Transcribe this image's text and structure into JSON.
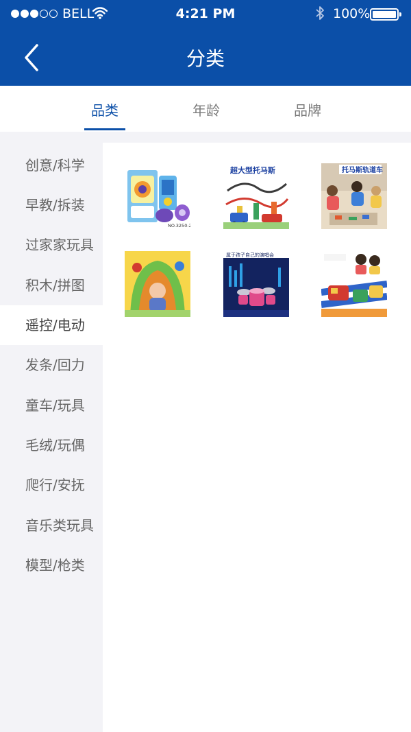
{
  "status_bar": {
    "carrier": "BELL",
    "time": "4:21 PM",
    "battery": "100%",
    "signal_bars_filled": 3,
    "signal_bars_total": 5
  },
  "nav": {
    "title": "分类",
    "back_icon": "chevron-left-icon"
  },
  "tabs": [
    {
      "label": "品类",
      "active": true
    },
    {
      "label": "年龄",
      "active": false
    },
    {
      "label": "品牌",
      "active": false
    }
  ],
  "categories": [
    {
      "label": "创意/科学"
    },
    {
      "label": "早教/拆装"
    },
    {
      "label": "过家家玩具"
    },
    {
      "label": "积木/拼图"
    },
    {
      "label": "遥控/电动",
      "active": true
    },
    {
      "label": "发条/回力"
    },
    {
      "label": "童车/玩具"
    },
    {
      "label": "毛绒/玩偶"
    },
    {
      "label": "爬行/安抚"
    },
    {
      "label": "音乐类玩具"
    },
    {
      "label": "模型/枪类"
    }
  ],
  "products": [
    {
      "caption": "NO.3250-2",
      "theme": "toy-box"
    },
    {
      "caption": "超大型托马斯",
      "theme": "train-track"
    },
    {
      "caption": "托马斯轨道车",
      "theme": "kids-playing"
    },
    {
      "caption": "",
      "theme": "baby-playmat"
    },
    {
      "caption": "属于孩子自己的演唱会",
      "theme": "drum-set"
    },
    {
      "caption": "",
      "theme": "train-kids"
    }
  ],
  "colors": {
    "brand_blue": "#0b4fa8",
    "sidebar_bg": "#f3f3f7"
  }
}
